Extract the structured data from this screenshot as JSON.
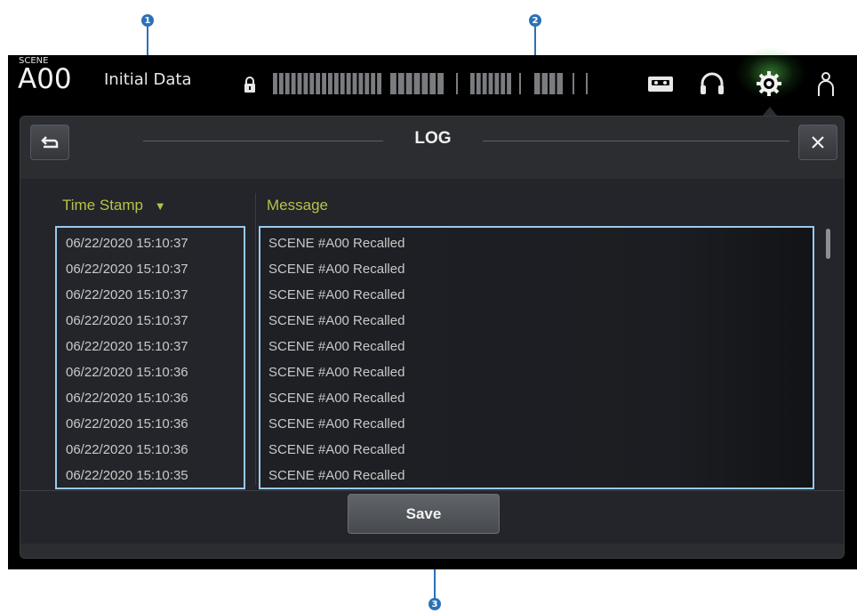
{
  "callouts": [
    "1",
    "2",
    "3"
  ],
  "scene": {
    "label": "SCENE",
    "number": "A00",
    "title": "Initial Data"
  },
  "topbar_icons": [
    "lock-icon",
    "recorder-icon",
    "headphones-icon",
    "gear-icon",
    "user-icon"
  ],
  "colors": {
    "accent_yellow": "#b8c14a",
    "highlight_blue": "#9cc9ec",
    "callout_blue": "#2b71b8",
    "glow_green": "#5ad250"
  },
  "dialog": {
    "title": "LOG",
    "back_icon": "back-arrow-icon",
    "close_icon": "close-icon"
  },
  "log": {
    "columns": {
      "timestamp": "Time Stamp",
      "message": "Message"
    },
    "sort_indicator": "▼",
    "rows": [
      {
        "time": "06/22/2020 15:10:37",
        "message": "SCENE #A00 Recalled"
      },
      {
        "time": "06/22/2020 15:10:37",
        "message": "SCENE #A00 Recalled"
      },
      {
        "time": "06/22/2020 15:10:37",
        "message": "SCENE #A00 Recalled"
      },
      {
        "time": "06/22/2020 15:10:37",
        "message": "SCENE #A00 Recalled"
      },
      {
        "time": "06/22/2020 15:10:37",
        "message": "SCENE #A00 Recalled"
      },
      {
        "time": "06/22/2020 15:10:36",
        "message": "SCENE #A00 Recalled"
      },
      {
        "time": "06/22/2020 15:10:36",
        "message": "SCENE #A00 Recalled"
      },
      {
        "time": "06/22/2020 15:10:36",
        "message": "SCENE #A00 Recalled"
      },
      {
        "time": "06/22/2020 15:10:36",
        "message": "SCENE #A00 Recalled"
      },
      {
        "time": "06/22/2020 15:10:35",
        "message": "SCENE #A00 Recalled"
      }
    ]
  },
  "save_label": "Save"
}
